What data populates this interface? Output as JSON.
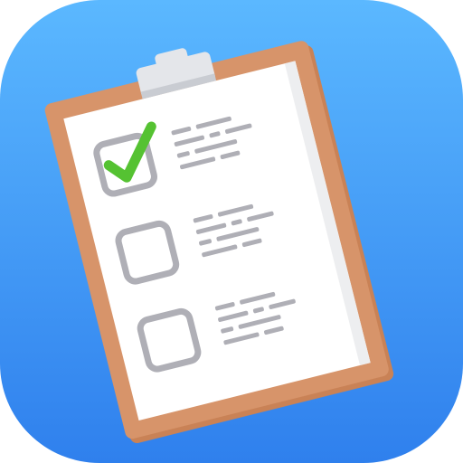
{
  "app_icon": {
    "icon": "clipboard-checklist-icon",
    "colors": {
      "background_top": "#5BB8FF",
      "background_bottom": "#2F80ED",
      "board": "#D7946A",
      "board_edge": "#C98256",
      "paper": "#FFFFFF",
      "paper_shade": "#EDEEF0",
      "clip": "#E4E6EA",
      "clip_shade": "#C9CCD2",
      "checkbox": "#AFAFB6",
      "text_lines": "#AFAFB6",
      "check": "#55C232"
    },
    "checklist": [
      {
        "checked": true
      },
      {
        "checked": false
      },
      {
        "checked": false
      }
    ]
  }
}
